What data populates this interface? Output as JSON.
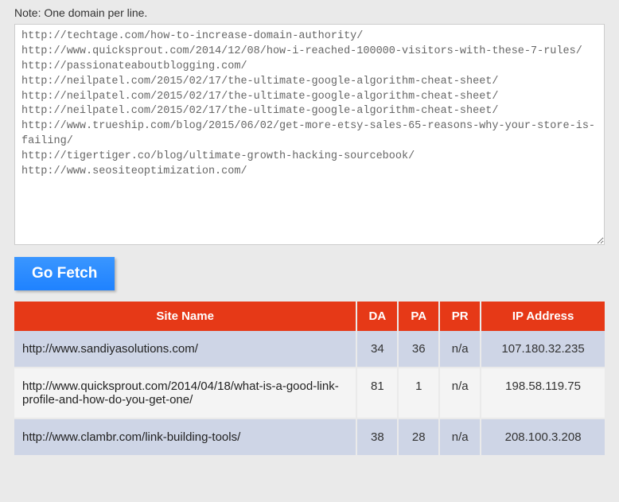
{
  "note": "Note: One domain per line.",
  "textarea_value": "http://techtage.com/how-to-increase-domain-authority/\nhttp://www.quicksprout.com/2014/12/08/how-i-reached-100000-visitors-with-these-7-rules/\nhttp://passionateaboutblogging.com/\nhttp://neilpatel.com/2015/02/17/the-ultimate-google-algorithm-cheat-sheet/\nhttp://neilpatel.com/2015/02/17/the-ultimate-google-algorithm-cheat-sheet/\nhttp://neilpatel.com/2015/02/17/the-ultimate-google-algorithm-cheat-sheet/\nhttp://www.trueship.com/blog/2015/06/02/get-more-etsy-sales-65-reasons-why-your-store-is-failing/\nhttp://tigertiger.co/blog/ultimate-growth-hacking-sourcebook/\nhttp://www.seositeoptimization.com/",
  "button_label": "Go Fetch",
  "table": {
    "headers": {
      "site": "Site Name",
      "da": "DA",
      "pa": "PA",
      "pr": "PR",
      "ip": "IP Address"
    },
    "rows": [
      {
        "site": "http://www.sandiyasolutions.com/",
        "da": "34",
        "pa": "36",
        "pr": "n/a",
        "ip": "107.180.32.235"
      },
      {
        "site": "http://www.quicksprout.com/2014/04/18/what-is-a-good-link-profile-and-how-do-you-get-one/",
        "da": "81",
        "pa": "1",
        "pr": "n/a",
        "ip": "198.58.119.75"
      },
      {
        "site": "http://www.clambr.com/link-building-tools/",
        "da": "38",
        "pa": "28",
        "pr": "n/a",
        "ip": "208.100.3.208"
      }
    ]
  }
}
